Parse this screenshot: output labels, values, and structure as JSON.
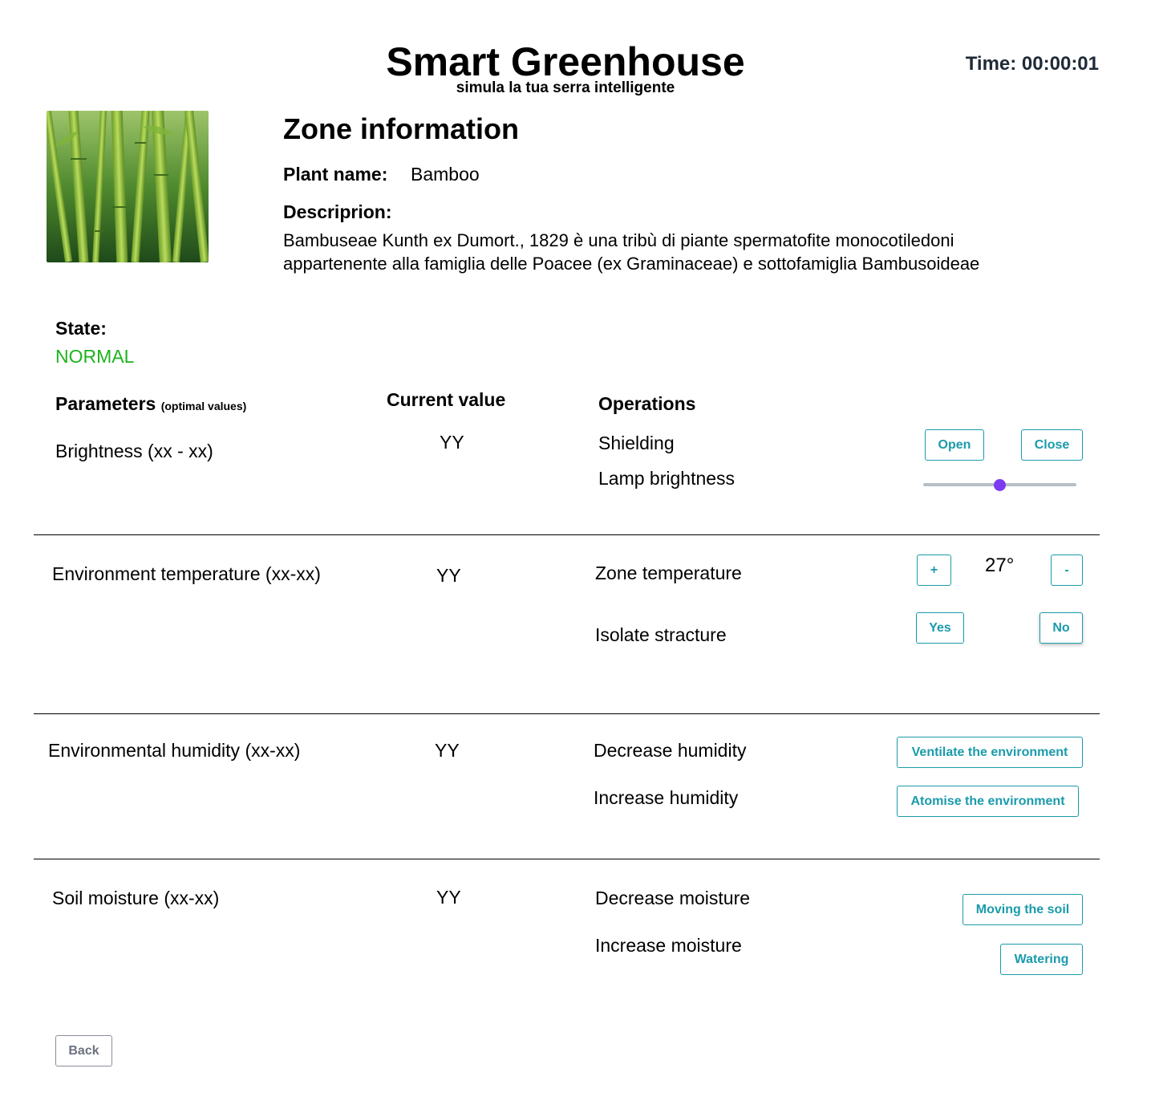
{
  "header": {
    "title": "Smart Greenhouse",
    "subtitle": "simula la tua serra intelligente",
    "timer": "Time: 00:00:01"
  },
  "zone": {
    "title": "Zone information",
    "plant_name_label": "Plant name:",
    "plant_name": "Bamboo",
    "description_label": "Descriprion:",
    "description": "Bambuseae Kunth ex Dumort., 1829 è una tribù di piante spermatofite monocotiledoni appartenente alla famiglia delle Poacee (ex Graminaceae) e sottofamiglia Bambusoideae",
    "image_icon": "bamboo-photo"
  },
  "state": {
    "label": "State:",
    "value": "NORMAL",
    "color": "#1db31d"
  },
  "table": {
    "headers": {
      "parameters": "Parameters",
      "parameters_note": "(optimal values)",
      "current": "Current value",
      "operations": "Operations"
    },
    "rows": [
      {
        "parameter": "Brightness (xx - xx)",
        "current": "YY",
        "op1": "Shielding",
        "op1_buttons": [
          "Open",
          "Close"
        ],
        "op2": "Lamp brightness",
        "slider_level": 0.5
      },
      {
        "parameter": "Environment temperature (xx-xx)",
        "current": "YY",
        "op1": "Zone temperature",
        "plus": "+",
        "minus": "-",
        "temperature": "27°",
        "op2": "Isolate stracture",
        "op2_buttons": [
          "Yes",
          "No"
        ]
      },
      {
        "parameter": "Environmental humidity (xx-xx)",
        "current": "YY",
        "op1": "Decrease humidity",
        "op1_button": "Ventilate the environment",
        "op2": "Increase humidity",
        "op2_button": "Atomise the environment"
      },
      {
        "parameter": "Soil moisture (xx-xx)",
        "current": "YY",
        "op1": "Decrease moisture",
        "op1_button": "Moving the soil",
        "op2": "Increase moisture",
        "op2_button": "Watering"
      }
    ]
  },
  "footer": {
    "back": "Back"
  },
  "colors": {
    "accent": "#1a9bab",
    "slider_thumb": "#7b3cf0",
    "slider_track": "#b7bfc7"
  }
}
